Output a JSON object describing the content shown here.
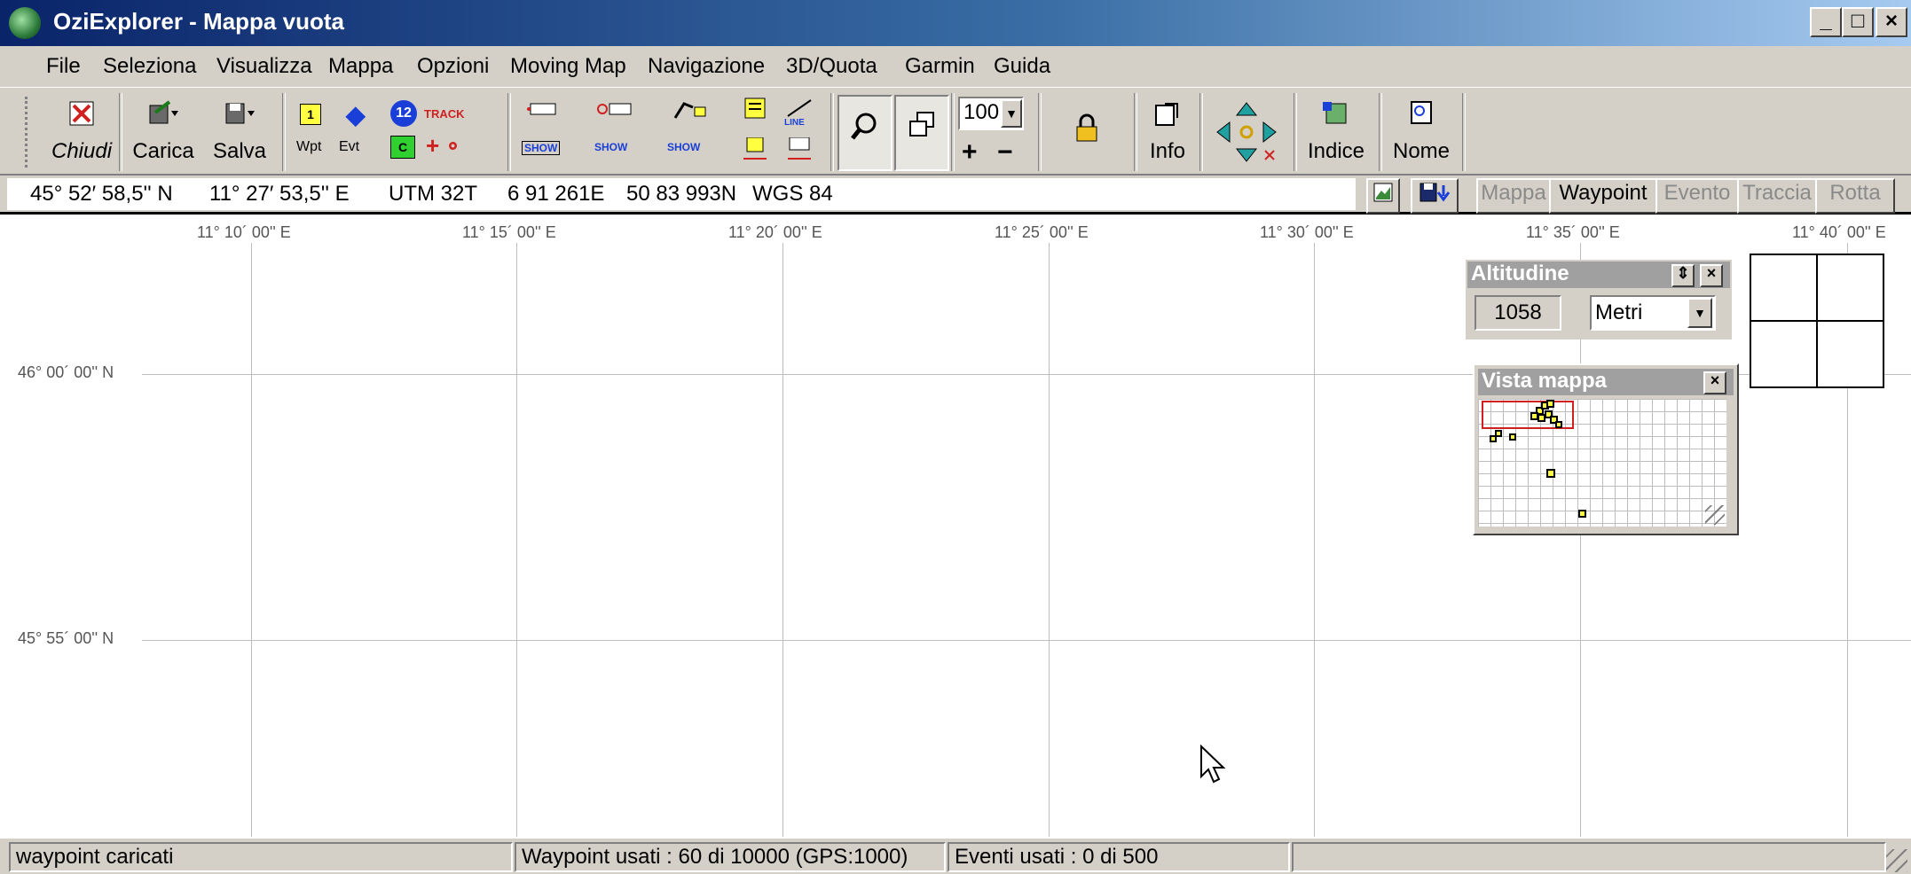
{
  "window": {
    "title": "OziExplorer - Mappa vuota",
    "min": "_",
    "max": "□",
    "close": "×"
  },
  "menu": [
    "File",
    "Seleziona",
    "Visualizza",
    "Mappa",
    "Opzioni",
    "Moving Map",
    "Navigazione",
    "3D/Quota",
    "Garmin",
    "Guida"
  ],
  "toolbar": {
    "close_label": "Chiudi",
    "load_label": "Carica",
    "save_label": "Salva",
    "wpt_label": "Wpt",
    "evt_label": "Evt",
    "wpt_box": "1",
    "track_mini": "TRACK",
    "route_badge": "12",
    "c_box": "C",
    "show_label": "SHOW",
    "line_label": "LINE",
    "zoom_value": "100",
    "info_label": "Info",
    "index_label": "Indice",
    "name_label": "Nome"
  },
  "coords": {
    "lat": "45° 52′ 58,5'' N",
    "lon": "11° 27′ 53,5'' E",
    "utm": "UTM 32T",
    "easting": "6 91 261E",
    "northing": "50 83 993N",
    "datum": "WGS 84"
  },
  "tabs": {
    "map": "Mappa",
    "waypoint": "Waypoint",
    "event": "Evento",
    "track": "Traccia",
    "route": "Rotta"
  },
  "grid": {
    "lon_labels": [
      "11° 10´ 00'' E",
      "11° 15´ 00'' E",
      "11° 20´ 00'' E",
      "11° 25´ 00'' E",
      "11° 30´ 00'' E",
      "11° 35´ 00'' E",
      "11° 40´ 00'' E"
    ],
    "lat_labels": [
      "46° 00´ 00'' N",
      "45° 55´ 00'' N"
    ]
  },
  "altitude": {
    "title": "Altitudine",
    "value": "1058",
    "unit": "Metri"
  },
  "overview": {
    "title": "Vista mappa"
  },
  "status": {
    "message": "waypoint caricati",
    "waypoints": "Waypoint usati : 60 di 10000  (GPS:1000)",
    "events": "Eventi usati : 0 di 500"
  },
  "colors": {
    "titlebar": "#0a246a",
    "face": "#d4d0c8",
    "grid": "#bdbdbd",
    "accent_blue": "#1a3fd8",
    "accent_red": "#d02020"
  }
}
